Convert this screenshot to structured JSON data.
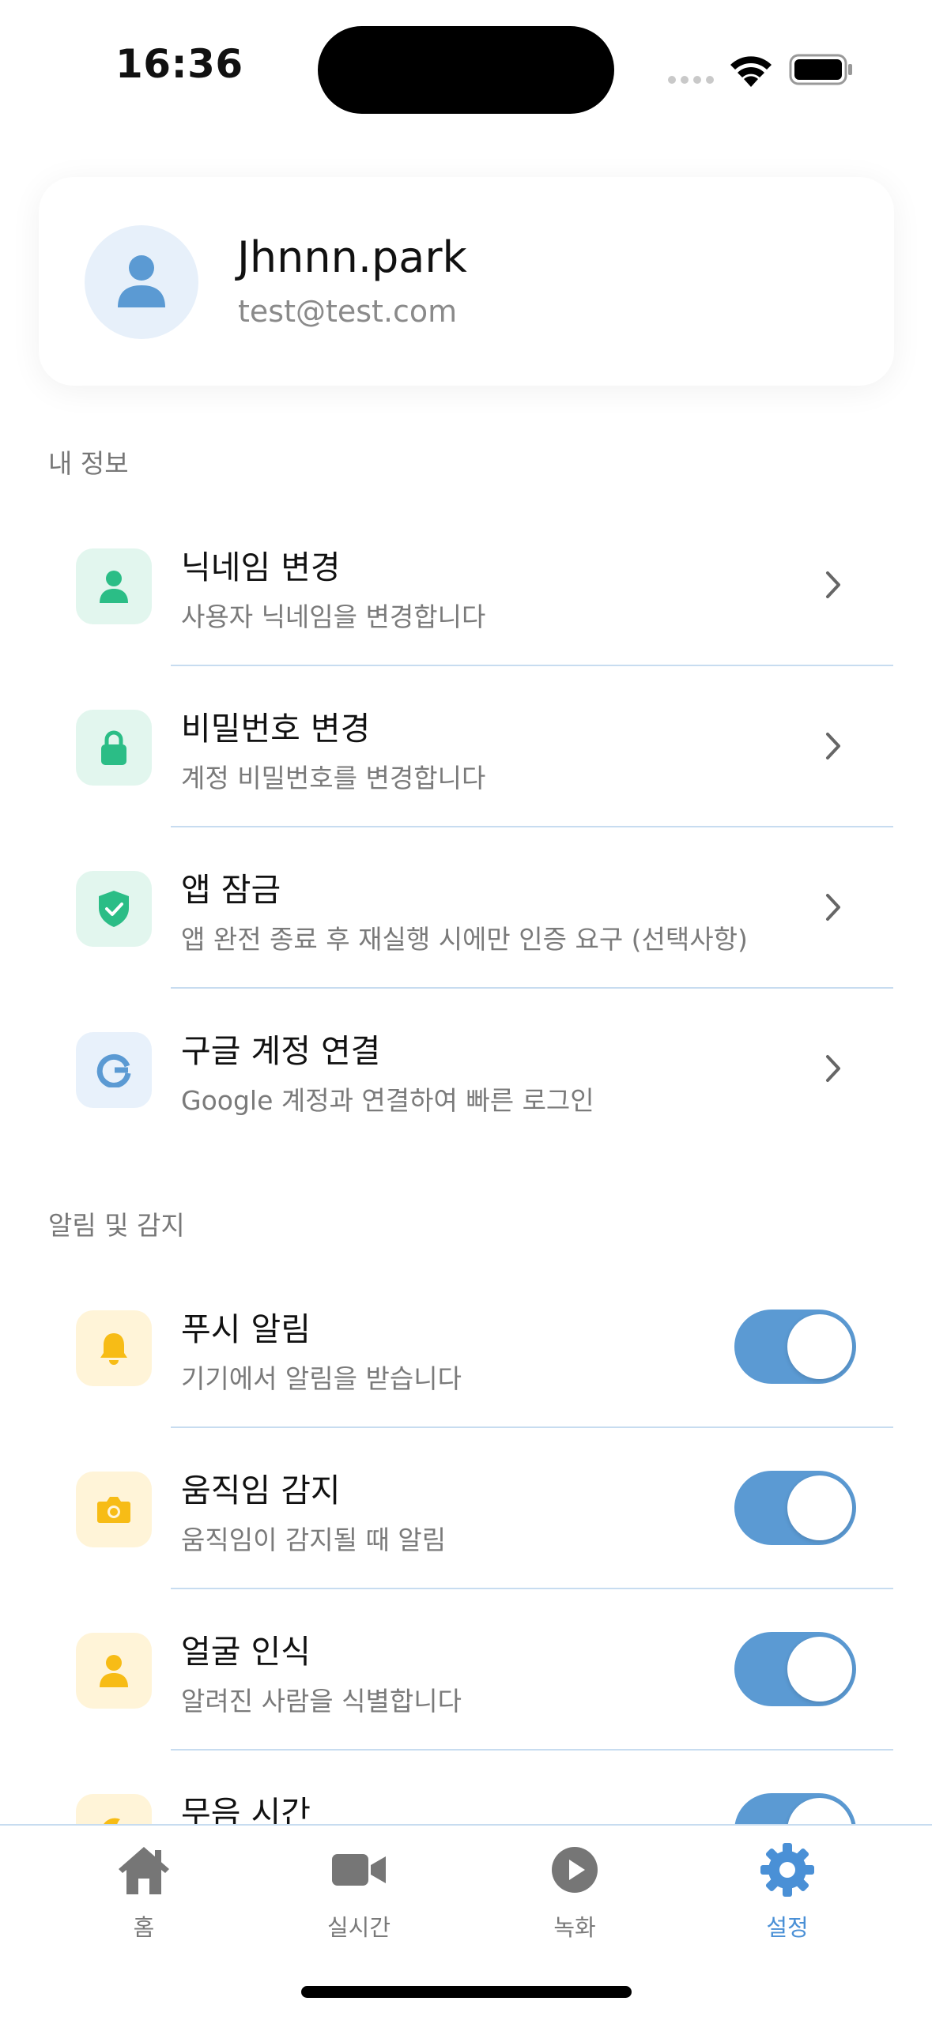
{
  "status_bar": {
    "time": "16:36"
  },
  "profile": {
    "name": "Jhnnn.park",
    "email": "test@test.com"
  },
  "my_info": {
    "title": "내 정보",
    "items": [
      {
        "title": "닉네임 변경",
        "subtitle": "사용자 닉네임을 변경합니다",
        "icon": "person-icon"
      },
      {
        "title": "비밀번호 변경",
        "subtitle": "계정 비밀번호를 변경합니다",
        "icon": "lock-icon"
      },
      {
        "title": "앱 잠금",
        "subtitle": "앱 완전 종료 후 재실행 시에만 인증 요구 (선택사항)",
        "icon": "shield-check-icon"
      },
      {
        "title": "구글 계정 연결",
        "subtitle": "Google 계정과 연결하여 빠른 로그인",
        "icon": "google-icon"
      }
    ]
  },
  "alerts": {
    "title": "알림 및 감지",
    "items": [
      {
        "title": "푸시 알림",
        "subtitle": "기기에서 알림을 받습니다",
        "icon": "bell-icon",
        "enabled": true
      },
      {
        "title": "움직임 감지",
        "subtitle": "움직임이 감지될 때 알림",
        "icon": "camera-icon",
        "enabled": true
      },
      {
        "title": "얼굴 인식",
        "subtitle": "알려진 사람을 식별합니다",
        "icon": "person-icon",
        "enabled": true
      },
      {
        "title": "무음 시간",
        "subtitle": "",
        "icon": "moon-icon",
        "enabled": true
      }
    ]
  },
  "tabs": [
    {
      "label": "홈",
      "icon": "home-icon",
      "active": false
    },
    {
      "label": "실시간",
      "icon": "video-camera-icon",
      "active": false
    },
    {
      "label": "녹화",
      "icon": "play-circle-icon",
      "active": false
    },
    {
      "label": "설정",
      "icon": "gear-icon",
      "active": true
    }
  ],
  "colors": {
    "accent": "#5b9ad3",
    "active_tab": "#4a90d6",
    "green_icon": "#2bbd86",
    "yellow_icon": "#f7bc16",
    "google_blue": "#5b9ad3",
    "divider": "#c7dcf0"
  }
}
